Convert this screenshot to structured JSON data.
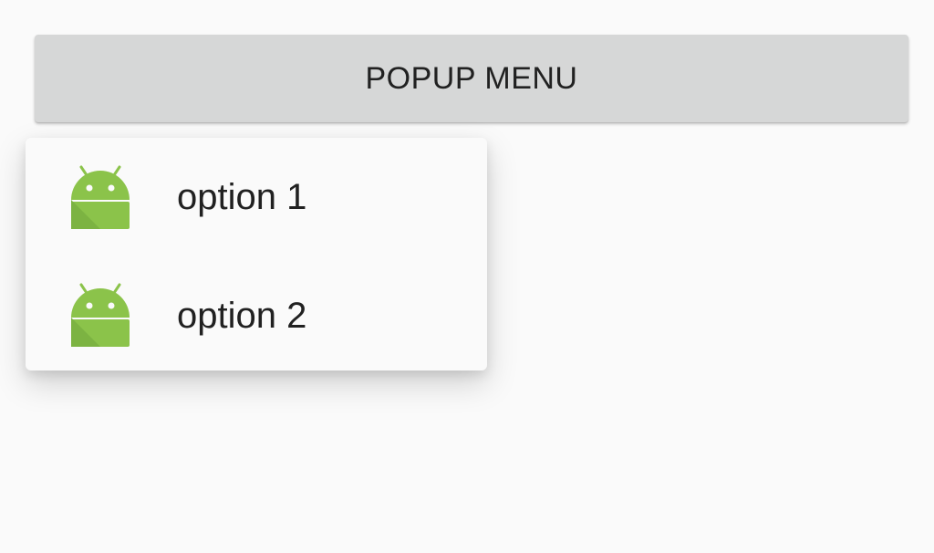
{
  "popup_button": {
    "label": "POPUP MENU"
  },
  "menu": {
    "items": [
      {
        "label": "option 1",
        "icon": "android-icon"
      },
      {
        "label": "option 2",
        "icon": "android-icon"
      }
    ]
  },
  "colors": {
    "background": "#fafafa",
    "button_background": "#d6d7d7",
    "text": "#212121",
    "android_green": "#8bc34a"
  }
}
